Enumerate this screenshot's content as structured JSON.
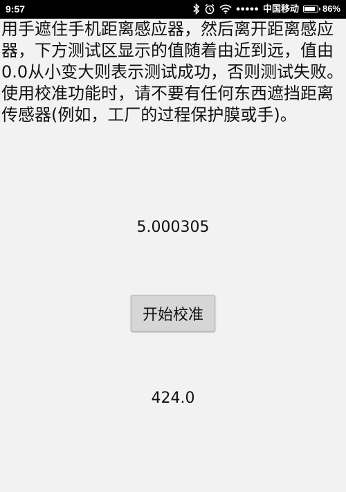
{
  "status_bar": {
    "time": "9:57",
    "signal": "●●●●●",
    "carrier": "中国移动",
    "battery_percent": "86%",
    "icons": [
      "bluetooth-icon",
      "alarm-clock-icon",
      "wifi-icon",
      "battery-icon"
    ],
    "battery_level": 0.86
  },
  "instructions": {
    "paragraph_1": "用手遮住手机距离感应器，然后离开距离感应器，下方测试区显示的值随着由近到远，值由0.0从小变大则表示测试成功，否则测试失败。",
    "paragraph_2": "使用校准功能时，请不要有任何东西遮挡距离传感器(例如，工厂的过程保护膜或手)。"
  },
  "sensor_value": "5.000305",
  "calibrate_button_label": "开始校准",
  "raw_value": "424.0"
}
